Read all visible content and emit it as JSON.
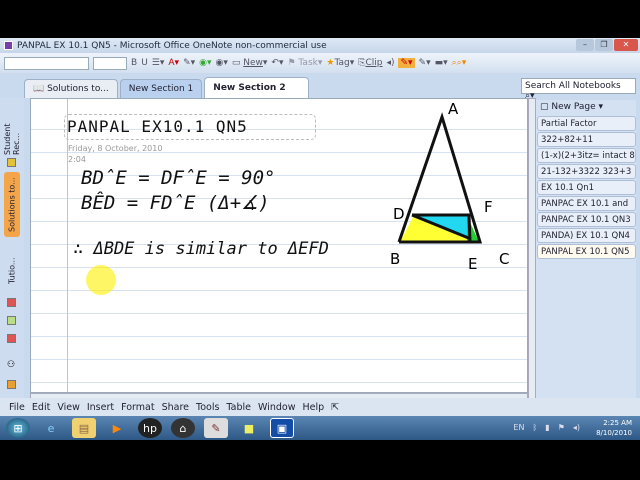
{
  "window": {
    "title": "PANPAL EX 10.1 QN5 - Microsoft Office OneNote non-commercial use"
  },
  "toolbar": {
    "new_label": "New",
    "task_label": "Task",
    "tag_label": "Tag",
    "clip_label": "Clip"
  },
  "tabs": [
    {
      "label": "Solutions to..."
    },
    {
      "label": "New Section 1"
    },
    {
      "label": "New Section 2"
    }
  ],
  "search": {
    "placeholder": "Search All Notebooks"
  },
  "notebooks": [
    {
      "label": "Student Rec..."
    },
    {
      "label": "Solutions to..."
    },
    {
      "label": "Tutio..."
    }
  ],
  "note": {
    "title": "PANPAL EX10.1 QN5",
    "date": "Friday, 8 October, 2010",
    "time": "2:04",
    "lines": [
      "BD̂E = DF̂E = 90°",
      "BÊD = FD̂E (Δ+∡)",
      "∴ ΔBDE is similar to ΔEFD"
    ],
    "diagram_labels": {
      "a": "A",
      "b": "B",
      "c": "C",
      "d": "D",
      "e": "E",
      "f": "F"
    }
  },
  "pages": {
    "new_page_label": "New Page",
    "items": [
      "Partial Factor",
      "322+82+11",
      "(1-x)(2+3itz= intact 8",
      "21-132+3322  323+3",
      "EX 10.1 Qn1",
      "PANPAC EX 10.1 and",
      "PANPAC EX 10.1 QN3",
      "PANDA) EX 10.1 QN4",
      "PANPAL EX 10.1 QN5"
    ]
  },
  "menu": [
    "File",
    "Edit",
    "View",
    "Insert",
    "Format",
    "Share",
    "Tools",
    "Table",
    "Window",
    "Help"
  ],
  "tray": {
    "lang": "EN",
    "time": "2:25 AM",
    "date": "8/10/2010"
  }
}
